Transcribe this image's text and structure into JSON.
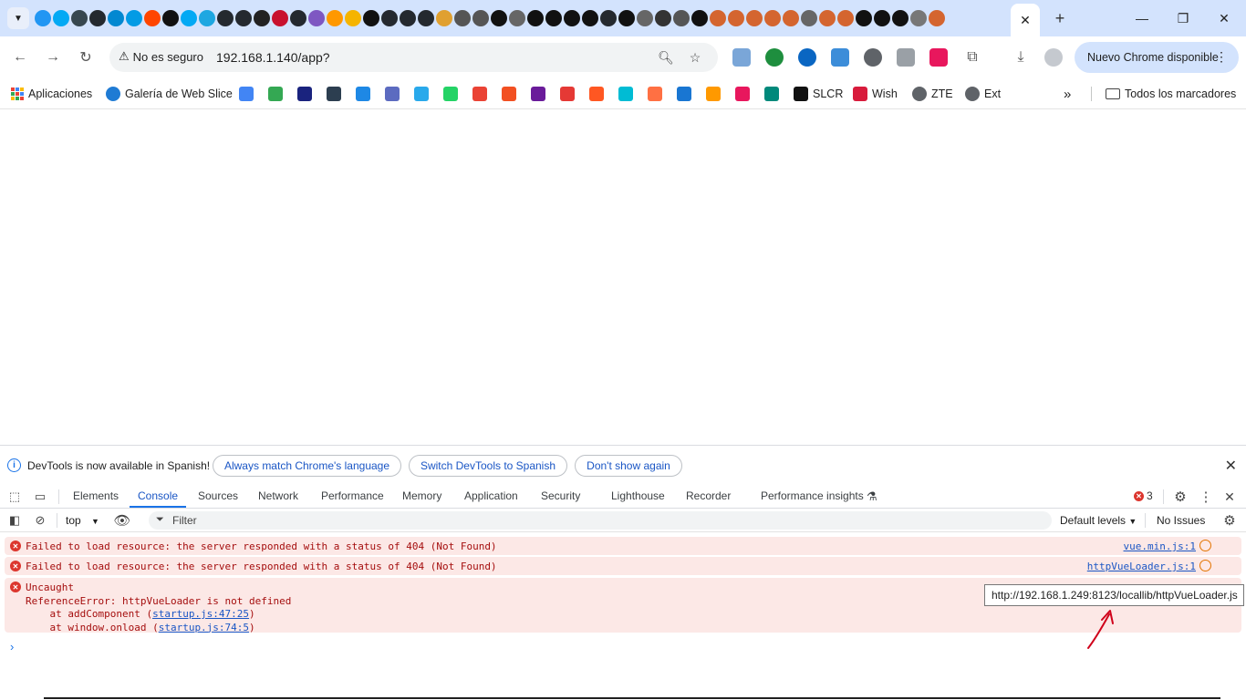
{
  "browser": {
    "active_tab_close": "✕",
    "new_tab": "+",
    "window_controls": [
      "—",
      "❐",
      "✕"
    ]
  },
  "toolbar": {
    "security_label": "No es seguro",
    "url": "192.168.1.140/app?",
    "update_label": "Nuevo Chrome disponible"
  },
  "bookmarks": {
    "apps_label": "Aplicaciones",
    "webslice_label": "Galería de Web Slice",
    "slcr_label": "SLCR",
    "wish_label": "Wish",
    "zte_label": "ZTE",
    "ext_label": "Ext",
    "more": "»",
    "all_bookmarks": "Todos los marcadores"
  },
  "devtools": {
    "info_text": "DevTools is now available in Spanish!",
    "btn_match": "Always match Chrome's language",
    "btn_switch": "Switch DevTools to Spanish",
    "btn_dont_show": "Don't show again",
    "tabs": {
      "elements": "Elements",
      "console": "Console",
      "sources": "Sources",
      "network": "Network",
      "performance": "Performance",
      "memory": "Memory",
      "application": "Application",
      "security": "Security",
      "lighthouse": "Lighthouse",
      "recorder": "Recorder",
      "perf_insights": "Performance insights"
    },
    "error_count": "3",
    "context": "top",
    "filter_placeholder": "Filter",
    "default_levels": "Default levels",
    "no_issues": "No Issues"
  },
  "console": {
    "msg1": {
      "text": "Failed to load resource: the server responded with a status of 404 (Not Found)",
      "source": "vue.min.js:1"
    },
    "msg2": {
      "text": "Failed to load resource: the server responded with a status of 404 (Not Found)",
      "source": "httpVueLoader.js:1"
    },
    "msg3": {
      "line1": "Uncaught",
      "line2": "ReferenceError: httpVueLoader is not defined",
      "line3_prefix": "    at addComponent (",
      "line3_link": "startup.js:47:25",
      "line4_prefix": "    at window.onload (",
      "line4_link": "startup.js:74:5",
      "close_paren": ")"
    },
    "tooltip": "http://192.168.1.249:8123/locallib/httpVueLoader.js",
    "prompt": "›"
  },
  "colors": {
    "tabstrip": "#d3e3fd",
    "error_bg": "#fce8e6",
    "error_text": "#a50e0e",
    "link": "#1a56c5",
    "annotation": "#d0021b"
  }
}
